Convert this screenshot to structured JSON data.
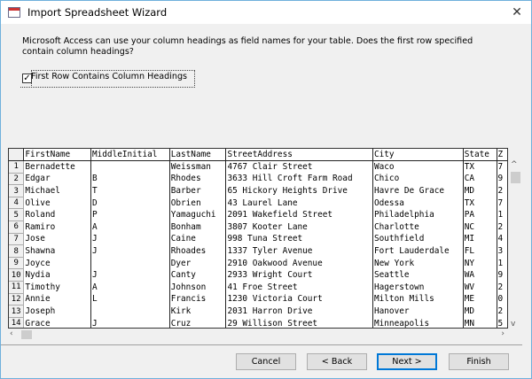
{
  "window": {
    "title": "Import Spreadsheet Wizard",
    "close": "✕"
  },
  "description": "Microsoft Access can use your column headings as field names for your table. Does the first row specified contain column headings?",
  "checkbox": {
    "label": "First Row Contains Column Headings",
    "checked": true
  },
  "table": {
    "columns": [
      "FirstName",
      "MiddleInitial",
      "LastName",
      "StreetAddress",
      "City",
      "State",
      "Z"
    ],
    "rows": [
      [
        "1",
        "Bernadette",
        "",
        "Weissman",
        "4767 Clair Street",
        "Waco",
        "TX",
        "7"
      ],
      [
        "2",
        "Edgar",
        "B",
        "Rhodes",
        "3633 Hill Croft Farm Road",
        "Chico",
        "CA",
        "9"
      ],
      [
        "3",
        "Michael",
        "T",
        "Barber",
        "65 Hickory Heights Drive",
        "Havre De Grace",
        "MD",
        "2"
      ],
      [
        "4",
        "Olive",
        "D",
        "Obrien",
        "43 Laurel Lane",
        "Odessa",
        "TX",
        "7"
      ],
      [
        "5",
        "Roland",
        "P",
        "Yamaguchi",
        "2091 Wakefield Street",
        "Philadelphia",
        "PA",
        "1"
      ],
      [
        "6",
        "Ramiro",
        "A",
        "Bonham",
        "3807 Kooter Lane",
        "Charlotte",
        "NC",
        "2"
      ],
      [
        "7",
        "Jose",
        "J",
        "Caine",
        "998 Tuna Street",
        "Southfield",
        "MI",
        "4"
      ],
      [
        "8",
        "Shawna",
        "J",
        "Rhoades",
        "1337 Tyler Avenue",
        "Fort Lauderdale",
        "FL",
        "3"
      ],
      [
        "9",
        "Joyce",
        "",
        "Dyer",
        "2910 Oakwood Avenue",
        "New York",
        "NY",
        "1"
      ],
      [
        "10",
        "Nydia",
        "J",
        "Canty",
        "2933 Wright Court",
        "Seattle",
        "WA",
        "9"
      ],
      [
        "11",
        "Timothy",
        "A",
        "Johnson",
        "41 Froe Street",
        "Hagerstown",
        "WV",
        "2"
      ],
      [
        "12",
        "Annie",
        "L",
        "Francis",
        "1230 Victoria Court",
        "Milton Mills",
        "ME",
        "0"
      ],
      [
        "13",
        "Joseph",
        "",
        "Kirk",
        "2031 Harron Drive",
        "Hanover",
        "MD",
        "2"
      ],
      [
        "14",
        "Grace",
        "J",
        "Cruz",
        "29 Willison Street",
        "Minneapolis",
        "MN",
        "5"
      ]
    ]
  },
  "buttons": {
    "cancel": "Cancel",
    "back": "< Back",
    "next": "Next >",
    "finish": "Finish"
  }
}
